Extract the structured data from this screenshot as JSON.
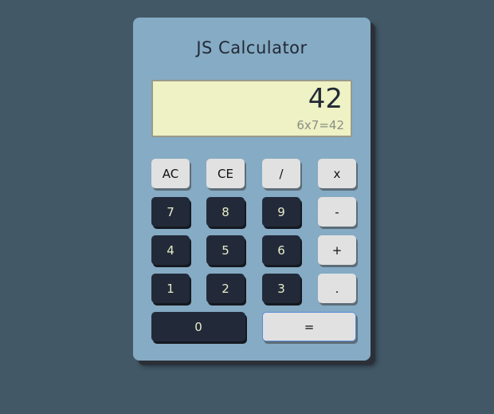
{
  "app": {
    "title": "JS Calculator"
  },
  "display": {
    "value": "42",
    "formula": "6x7=42"
  },
  "buttons": {
    "ac": "AC",
    "ce": "CE",
    "divide": "/",
    "multiply": "x",
    "seven": "7",
    "eight": "8",
    "nine": "9",
    "subtract": "-",
    "four": "4",
    "five": "5",
    "six": "6",
    "add": "+",
    "one": "1",
    "two": "2",
    "three": "3",
    "decimal": ".",
    "zero": "0",
    "equals": "="
  },
  "colors": {
    "background": "#425867",
    "calculator_body": "#86abc4",
    "display_bg": "#eef2c4",
    "dark_key": "#222a3a",
    "light_key": "#e1e1e1",
    "dark_key_text": "#e8ecc6"
  }
}
